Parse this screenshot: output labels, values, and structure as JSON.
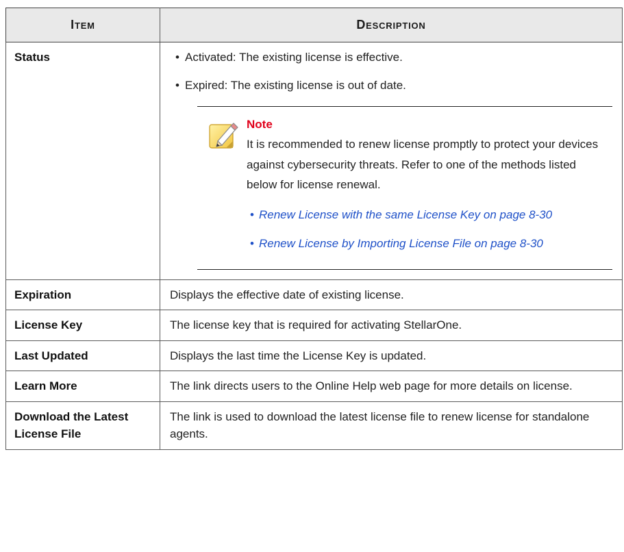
{
  "table": {
    "headers": [
      "Item",
      "Description"
    ],
    "status": {
      "item": "Status",
      "bullets": [
        "Activated: The existing license is effective.",
        "Expired: The existing license is out of date."
      ],
      "note": {
        "title": "Note",
        "icon": "note-pencil-icon",
        "body": "It is recommended to renew license promptly to protect your devices against cybersecurity threats. Refer to one of the methods listed below for license renewal.",
        "links": [
          "Renew License with the same License Key on page 8-30",
          "Renew License by Importing License File on page 8-30"
        ]
      }
    },
    "rows": [
      {
        "item": "Expiration",
        "description": "Displays the effective date of existing license."
      },
      {
        "item": "License Key",
        "description": "The license key that is required for activating StellarOne."
      },
      {
        "item": "Last Updated",
        "description": "Displays the last time the License Key is updated."
      },
      {
        "item": "Learn More",
        "description": "The link directs users to the Online Help web page for more details on license."
      },
      {
        "item": "Download the Latest License File",
        "description": "The link is used to download the latest license file to renew license for standalone agents."
      }
    ]
  },
  "colors": {
    "link": "#1e50c8",
    "note_title": "#e0001a",
    "header_bg": "#e9e9e9"
  }
}
